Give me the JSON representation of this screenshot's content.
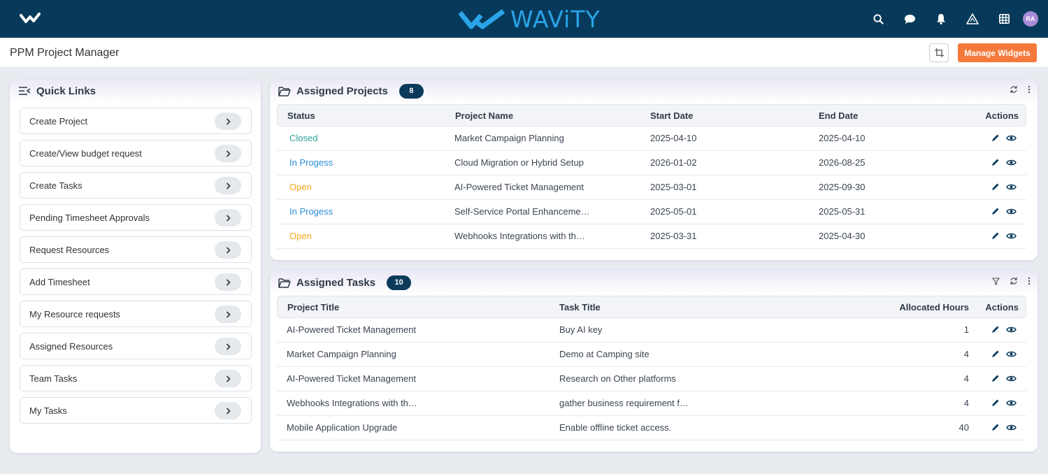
{
  "topbar": {
    "brand": "WAViTY",
    "avatar_initials": "RA",
    "icons": [
      "search-icon",
      "chat-icon",
      "bell-icon",
      "warning-icon",
      "grid-icon"
    ]
  },
  "page": {
    "title": "PPM Project Manager",
    "manage_widgets_label": "Manage Widgets"
  },
  "quick_links": {
    "title": "Quick Links",
    "items": [
      "Create Project",
      "Create/View budget request",
      "Create Tasks",
      "Pending Timesheet Approvals",
      "Request Resources",
      "Add Timesheet",
      "My Resource requests",
      "Assigned Resources",
      "Team Tasks",
      "My Tasks"
    ]
  },
  "assigned_projects": {
    "title": "Assigned Projects",
    "count": "8",
    "columns": [
      "Status",
      "Project Name",
      "Start Date",
      "End Date",
      "Actions"
    ],
    "rows": [
      {
        "status": "Closed",
        "name": "Market Campaign Planning",
        "start": "2025-04-10",
        "end": "2025-04-10"
      },
      {
        "status": "In Progess",
        "name": "Cloud Migration or Hybrid Setup",
        "start": "2026-01-02",
        "end": "2026-08-25"
      },
      {
        "status": "Open",
        "name": "AI-Powered Ticket Management",
        "start": "2025-03-01",
        "end": "2025-09-30"
      },
      {
        "status": "In Progess",
        "name": "Self-Service Portal Enhanceme…",
        "start": "2025-05-01",
        "end": "2025-05-31"
      },
      {
        "status": "Open",
        "name": "Webhooks Integrations with th…",
        "start": "2025-03-31",
        "end": "2025-04-30"
      }
    ],
    "colors": {
      "Closed": "#2aa39a",
      "In Progess": "#2b8fd6",
      "Open": "#f0a818"
    }
  },
  "assigned_tasks": {
    "title": "Assigned Tasks",
    "count": "10",
    "columns": [
      "Project Title",
      "Task Title",
      "Allocated Hours",
      "Actions"
    ],
    "rows": [
      {
        "project": "AI-Powered Ticket Management",
        "task": "Buy AI key",
        "hours": "1"
      },
      {
        "project": "Market Campaign Planning",
        "task": "Demo at Camping site",
        "hours": "4"
      },
      {
        "project": "AI-Powered Ticket Management",
        "task": "Research on Other platforms",
        "hours": "4"
      },
      {
        "project": "Webhooks Integrations with th…",
        "task": "gather business requirement f…",
        "hours": "4"
      },
      {
        "project": "Mobile Application Upgrade",
        "task": "Enable offline ticket access.",
        "hours": "40"
      }
    ]
  },
  "colors": {
    "topbar": "#073a5a",
    "brand": "#2aa3e8",
    "accent_orange": "#f5793b",
    "badge": "#0b3a5a",
    "action_icon": "#0b3a5a"
  }
}
